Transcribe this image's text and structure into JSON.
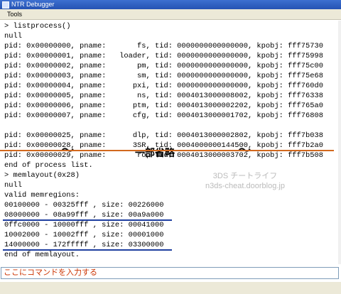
{
  "window": {
    "title": "NTR Debugger"
  },
  "menu": {
    "tools": "Tools"
  },
  "console": {
    "lines": [
      "> listprocess()",
      "null",
      "pid: 0x00000000, pname:       fs, tid: 0000000000000000, kpobj: fff75730",
      "pid: 0x00000001, pname:   loader, tid: 0000000000000000, kpobj: fff75998",
      "pid: 0x00000002, pname:       pm, tid: 0000000000000000, kpobj: fff75c00",
      "pid: 0x00000003, pname:       sm, tid: 0000000000000000, kpobj: fff75e68",
      "pid: 0x00000004, pname:      pxi, tid: 0000000000000000, kpobj: fff760d0",
      "pid: 0x00000005, pname:       ns, tid: 0004013000008002, kpobj: fff76338",
      "pid: 0x00000006, pname:      ptm, tid: 0004013000002202, kpobj: fff765a0",
      "pid: 0x00000007, pname:      cfg, tid: 0004013000001702, kpobj: fff76808",
      "pid: 0x00000025, pname:      dlp, tid: 0004013000002802, kpobj: fff7b038",
      "pid: 0x00000028, pname:      3SR, tid: 0004000000144500, kpobj: fff7b2a0",
      "pid: 0x00000029, pname:       ro, tid: 0004013000003702, kpobj: fff7b508",
      "end of process list.",
      "> memlayout(0x28)",
      "null",
      "valid memregions:",
      "00100000 - 00325fff , size: 00226000",
      "08000000 - 08a99fff , size: 00a9a000",
      "0ffc0000 - 10000fff , size: 00041000",
      "10002000 - 10002fff , size: 00001000",
      "14000000 - 172fffff , size: 03300000",
      "end of memlayout."
    ],
    "omitted_label": "一部省略",
    "tilde": "〜"
  },
  "watermark": {
    "line1": "3DS チートライフ",
    "line2": "n3ds-cheat.doorblog.jp"
  },
  "command": {
    "placeholder": "ここにコマンドを入力する"
  },
  "colors": {
    "title_bar": "#2553b3",
    "highlight_process": "#d2691e",
    "highlight_mem": "#1f3fa0",
    "command_text": "#cc3300"
  }
}
